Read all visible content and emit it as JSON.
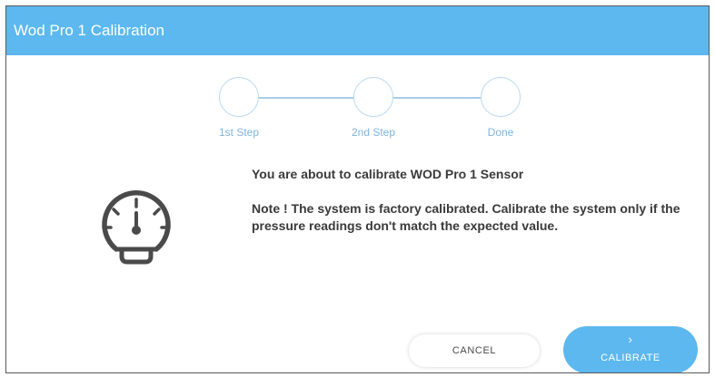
{
  "window": {
    "title": "Wod Pro 1 Calibration"
  },
  "stepper": {
    "steps": [
      {
        "label": "1st Step"
      },
      {
        "label": "2nd Step"
      },
      {
        "label": "Done"
      }
    ]
  },
  "content": {
    "icon": "pressure-gauge-icon",
    "heading": "You are about to calibrate WOD Pro 1 Sensor",
    "note": "Note ! The system is factory calibrated. Calibrate the system only if the pressure readings don't match the expected value."
  },
  "actions": {
    "cancel_label": "CANCEL",
    "calibrate_icon": "chevron-right-icon",
    "calibrate_glyph": "›",
    "calibrate_label": "CALIBRATE"
  },
  "colors": {
    "accent": "#5cb8ef",
    "step_outline": "#b9d9f0",
    "step_label": "#7fb4df",
    "text": "#3a3a3a",
    "icon": "#4a4a4a"
  }
}
